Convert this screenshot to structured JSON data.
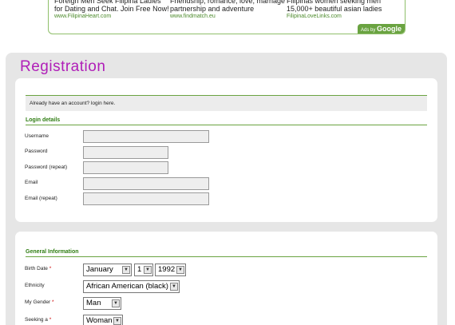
{
  "ads": {
    "items": [
      {
        "headline": "Foreign Men Seek Filipina Ladies for Dating and Chat. Join Free Now!",
        "url": "www.FilipinaHeart.com"
      },
      {
        "headline": "Friendship, romance, love, marriage partnership and adventure",
        "url": "www.findmatch.eu"
      },
      {
        "headline": "Filipinas women seeking men 15,000+ beautiful asian ladies",
        "url": "FilipinaLoveLinks.com"
      }
    ],
    "ads_by_label": "Ads by",
    "ads_by_brand": "Google"
  },
  "page": {
    "title": "Registration"
  },
  "account_notice": "Already have an account? login here.",
  "login_section": {
    "title": "Login details",
    "username_label": "Username",
    "password_label": "Password",
    "password_repeat_label": "Password (repeat)",
    "email_label": "Email",
    "email_repeat_label": "Email (repeat)"
  },
  "general_section": {
    "title": "General Information",
    "birth_date_label": "Birth Date",
    "birth_month": "January",
    "birth_day": "1",
    "birth_year": "1992",
    "ethnicity_label": "Ethnicity",
    "ethnicity_value": "African American (black)",
    "gender_label": "My Gender",
    "gender_value": "Man",
    "seeking_label": "Seeking a",
    "seeking_value": "Woman",
    "required_mark": "*"
  },
  "colors": {
    "title": "#b01eb8",
    "section_green": "#2f7d12",
    "rule_green": "#6aa341",
    "required": "#cc0000"
  },
  "icons": {
    "select_arrow": "chevron-down-icon"
  }
}
